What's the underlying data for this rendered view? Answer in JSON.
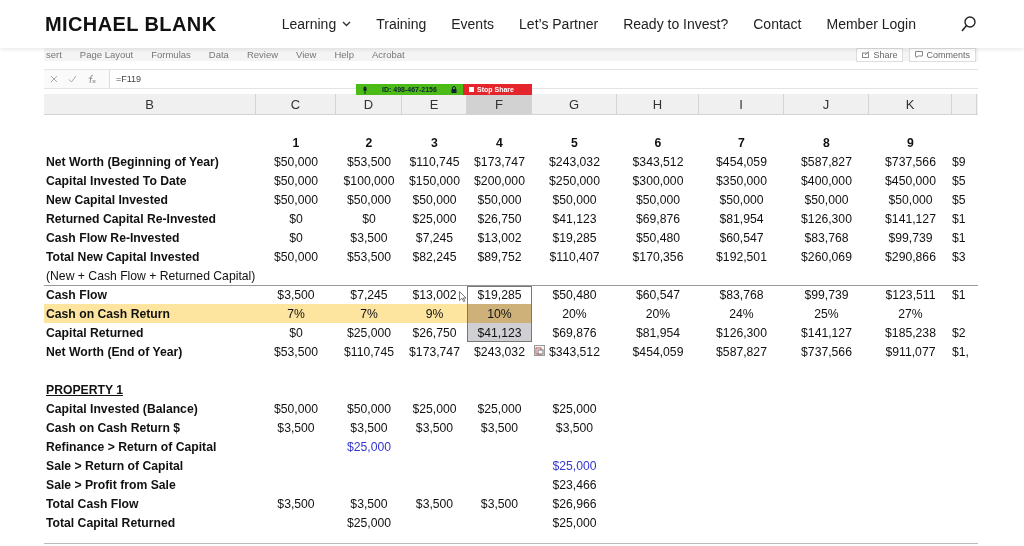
{
  "site": {
    "logo": "MICHAEL BLANK",
    "nav": [
      {
        "label": "Learning",
        "dropdown": true
      },
      {
        "label": "Training",
        "dropdown": false
      },
      {
        "label": "Events",
        "dropdown": false
      },
      {
        "label": "Let’s Partner",
        "dropdown": false
      },
      {
        "label": "Ready to Invest?",
        "dropdown": false
      },
      {
        "label": "Contact",
        "dropdown": false
      },
      {
        "label": "Member Login",
        "dropdown": false
      }
    ]
  },
  "spreadsheet": {
    "ribbon_tabs": [
      "sert",
      "Page Layout",
      "Formulas",
      "Data",
      "Review",
      "View",
      "Help",
      "Acrobat"
    ],
    "ribbon_buttons": [
      "Share",
      "Comments"
    ],
    "formula": "=F119",
    "share_banner": {
      "id": "ID: 498-467-2156",
      "stop": "Stop Share"
    },
    "columns": [
      {
        "label": "B",
        "selected": false
      },
      {
        "label": "C",
        "selected": false
      },
      {
        "label": "D",
        "selected": false
      },
      {
        "label": "E",
        "selected": false
      },
      {
        "label": "F",
        "selected": true
      },
      {
        "label": "G",
        "selected": false
      },
      {
        "label": "H",
        "selected": false
      },
      {
        "label": "I",
        "selected": false
      },
      {
        "label": "J",
        "selected": false
      },
      {
        "label": "K",
        "selected": false
      }
    ],
    "rows": [
      {
        "kind": "header",
        "cells": [
          "",
          "1",
          "2",
          "3",
          "4",
          "5",
          "6",
          "7",
          "8",
          "9",
          null
        ]
      },
      {
        "kind": "data",
        "cells": [
          "Net Worth (Beginning of Year)",
          "$50,000",
          "$53,500",
          "$110,745",
          "$173,747",
          "$243,032",
          "$343,512",
          "$454,059",
          "$587,827",
          "$737,566",
          "$9"
        ]
      },
      {
        "kind": "data",
        "cells": [
          "Capital Invested To Date",
          "$50,000",
          "$100,000",
          "$150,000",
          "$200,000",
          "$250,000",
          "$300,000",
          "$350,000",
          "$400,000",
          "$450,000",
          "$5"
        ]
      },
      {
        "kind": "data",
        "cells": [
          "New Capital Invested",
          "$50,000",
          "$50,000",
          "$50,000",
          "$50,000",
          "$50,000",
          "$50,000",
          "$50,000",
          "$50,000",
          "$50,000",
          "$5"
        ]
      },
      {
        "kind": "data",
        "cells": [
          "Returned Capital Re-Invested",
          "$0",
          "$0",
          "$25,000",
          "$26,750",
          "$41,123",
          "$69,876",
          "$81,954",
          "$126,300",
          "$141,127",
          "$1"
        ]
      },
      {
        "kind": "data",
        "cells": [
          "Cash Flow Re-Invested",
          "$0",
          "$3,500",
          "$7,245",
          "$13,002",
          "$19,285",
          "$50,480",
          "$60,547",
          "$83,768",
          "$99,739",
          "$1"
        ]
      },
      {
        "kind": "data",
        "cells": [
          "Total New Capital Invested",
          "$50,000",
          "$53,500",
          "$82,245",
          "$89,752",
          "$110,407",
          "$170,356",
          "$192,501",
          "$260,069",
          "$290,866",
          "$3"
        ]
      },
      {
        "kind": "note",
        "cells": [
          "(New + Cash Flow + Returned Capital)"
        ]
      },
      {
        "kind": "data",
        "rule_above": true,
        "cells": [
          "Cash Flow",
          "$3,500",
          "$7,245",
          "$13,002",
          {
            "value": "$19,285",
            "kind": "active"
          },
          "$50,480",
          "$60,547",
          "$83,768",
          "$99,739",
          "$123,511",
          "$1"
        ]
      },
      {
        "kind": "data",
        "highlighted": true,
        "cells": [
          "Cash on Cash Return",
          {
            "value": "7%",
            "kind": "highlight"
          },
          {
            "value": "7%",
            "kind": "highlight"
          },
          {
            "value": "9%",
            "kind": "highlight"
          },
          {
            "value": "10%",
            "kind": "selected-highlight"
          },
          "20%",
          "20%",
          "24%",
          "25%",
          "27%",
          null
        ]
      },
      {
        "kind": "data",
        "cells": [
          "Capital Returned",
          "$0",
          "$25,000",
          "$26,750",
          {
            "value": "$41,123",
            "kind": "selected-end"
          },
          "$69,876",
          "$81,954",
          "$126,300",
          "$141,127",
          "$185,238",
          "$2"
        ]
      },
      {
        "kind": "data",
        "cells": [
          "Net Worth (End of Year)",
          "$53,500",
          "$110,745",
          "$173,747",
          "$243,032",
          {
            "value": "$343,512",
            "kind": "paste-options"
          },
          "$454,059",
          "$587,827",
          "$737,566",
          "$911,077",
          "$1,"
        ]
      },
      {
        "kind": "blank",
        "cells": []
      },
      {
        "kind": "section",
        "cells": [
          "PROPERTY 1"
        ]
      },
      {
        "kind": "data",
        "cells": [
          "Capital Invested (Balance)",
          "$50,000",
          "$50,000",
          "$25,000",
          "$25,000",
          "$25,000"
        ]
      },
      {
        "kind": "data",
        "cells": [
          "Cash on Cash Return $",
          "$3,500",
          "$3,500",
          "$3,500",
          "$3,500",
          "$3,500"
        ]
      },
      {
        "kind": "data",
        "cells": [
          "Refinance > Return of Capital",
          null,
          {
            "value": "$25,000",
            "kind": "input"
          }
        ]
      },
      {
        "kind": "data",
        "cells": [
          "Sale > Return of Capital",
          null,
          null,
          null,
          null,
          {
            "value": "$25,000",
            "kind": "input"
          }
        ]
      },
      {
        "kind": "data",
        "cells": [
          "Sale > Profit from Sale",
          null,
          null,
          null,
          null,
          "$23,466"
        ]
      },
      {
        "kind": "data",
        "cells": [
          "Total Cash Flow",
          "$3,500",
          "$3,500",
          "$3,500",
          "$3,500",
          "$26,966"
        ]
      },
      {
        "kind": "data",
        "cells": [
          "Total Capital Returned",
          null,
          "$25,000",
          null,
          null,
          "$25,000"
        ]
      }
    ]
  }
}
